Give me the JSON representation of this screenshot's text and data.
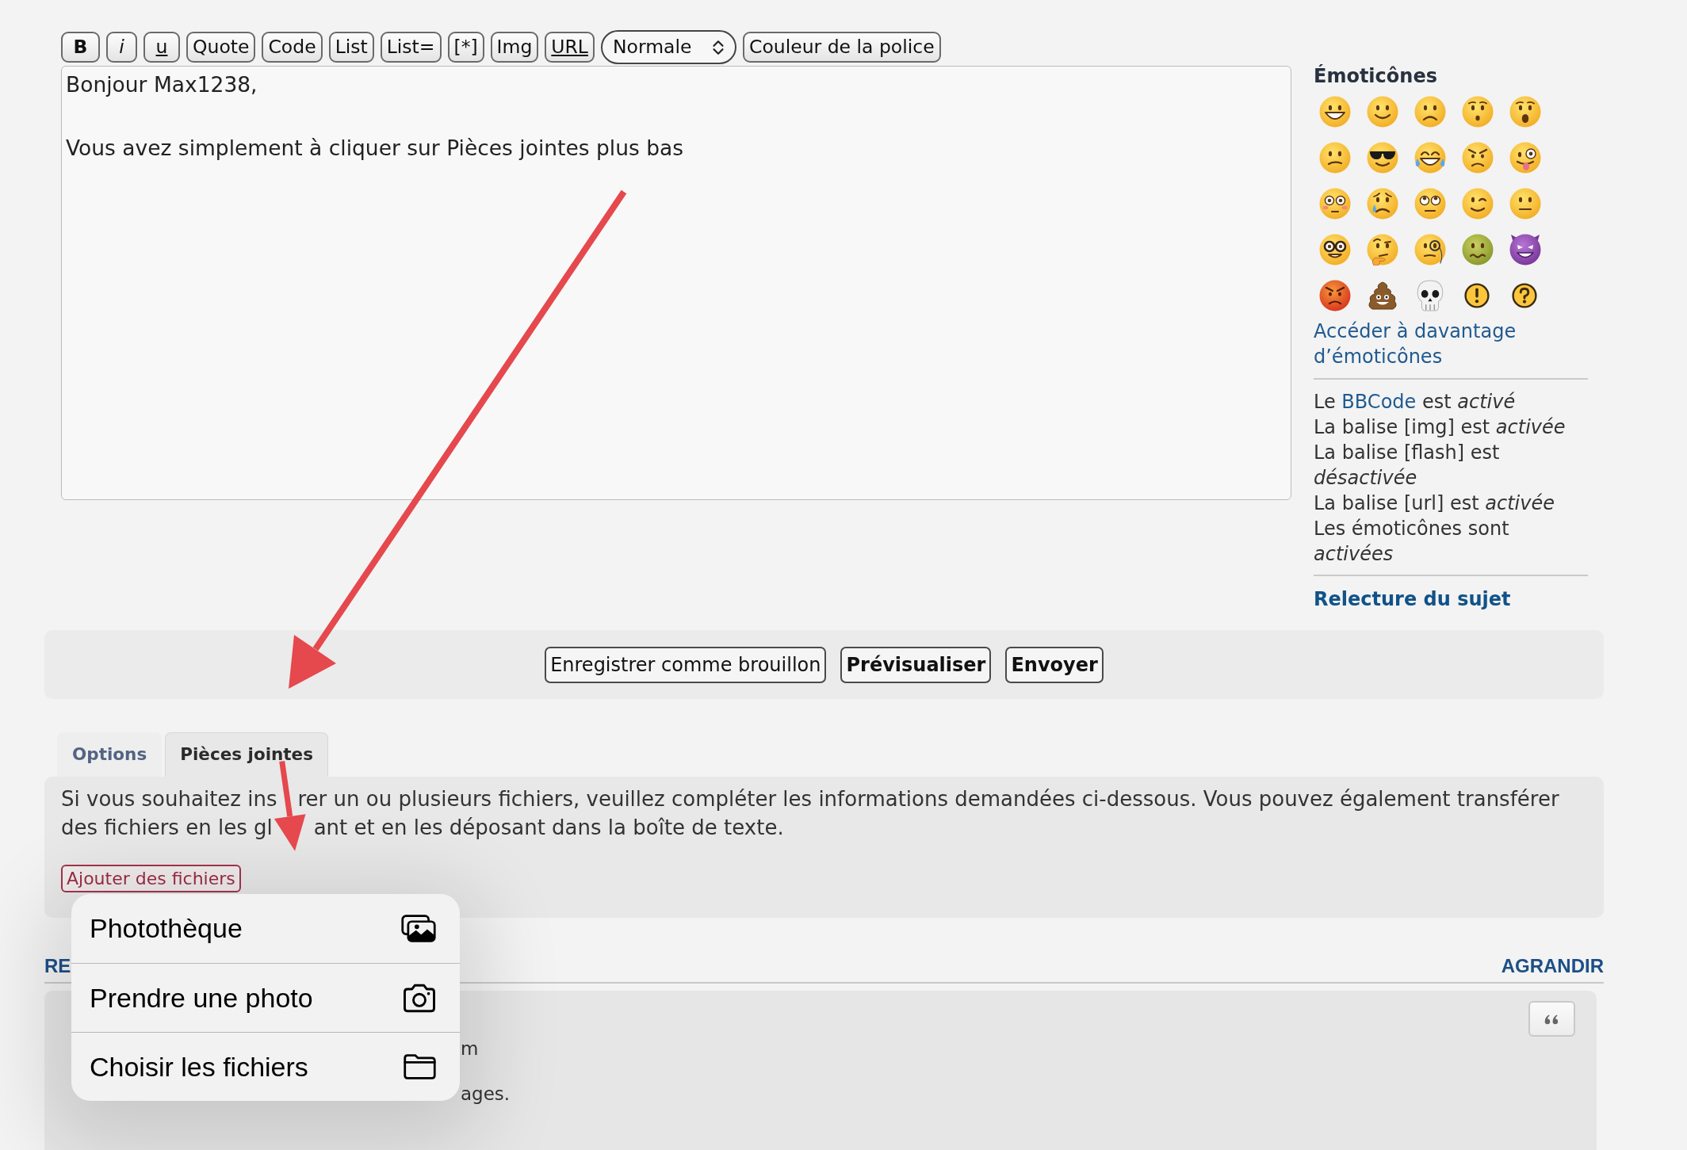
{
  "toolbar": [
    {
      "kind": "bold",
      "label": "B"
    },
    {
      "kind": "italic",
      "label": "i"
    },
    {
      "kind": "underline",
      "label": "u"
    },
    {
      "kind": "plain",
      "label": "Quote"
    },
    {
      "kind": "plain",
      "label": "Code"
    },
    {
      "kind": "plain",
      "label": "List"
    },
    {
      "kind": "plain",
      "label": "List="
    },
    {
      "kind": "plain",
      "label": "[*]"
    },
    {
      "kind": "plain",
      "label": "Img"
    },
    {
      "kind": "underline",
      "label": "URL"
    },
    {
      "kind": "select",
      "value": "Normale"
    },
    {
      "kind": "plain",
      "label": "Couleur de la police"
    }
  ],
  "message": {
    "value": "Bonjour Max1238,\n\nVous avez simplement à cliquer sur Pièces jointes plus bas"
  },
  "emoticons": {
    "title": "Émoticônes",
    "more_link": "Accéder à davantage d’émoticônes"
  },
  "status_lines": [
    {
      "kind": "link",
      "before": "Le",
      "link": "BBCode",
      "after": "est *activé*"
    },
    {
      "kind": "text",
      "text": "La balise [img] est *activée*"
    },
    {
      "kind": "text",
      "text": "La balise [flash] est *désactivée*"
    },
    {
      "kind": "text",
      "text": "La balise [url] est *activée*"
    },
    {
      "kind": "text",
      "text": "Les émoticônes sont *activées*"
    }
  ],
  "review_link": "Relecture du sujet",
  "actions": [
    {
      "label": "Enregistrer comme brouillon",
      "emphasized": false
    },
    {
      "label": "Prévisualiser",
      "emphasized": true
    },
    {
      "label": "Envoyer",
      "emphasized": true
    }
  ],
  "tabs": [
    {
      "label": "Options",
      "selected": false
    },
    {
      "label": "Pièces jointes",
      "selected": true
    }
  ],
  "attachments": {
    "description_lines": [
      [
        "Si vous souhaitez ins",
        "rer un ou plusieurs fichiers, veuillez compléter les informations demandées ci-dessous. Vous pouvez également transférer"
      ],
      [
        "des fichiers en les gl",
        "ant et en les déposant dans la boîte de texte."
      ]
    ],
    "add_button": "Ajouter des fichiers"
  },
  "file_menu": [
    {
      "kind": "photos",
      "label": "Photothèque"
    },
    {
      "kind": "camera",
      "label": "Prendre une photo"
    },
    {
      "kind": "folder",
      "label": "Choisir les fichiers"
    }
  ],
  "review": {
    "heading": "RE",
    "expand_link": "AGRANDIR",
    "fragments": [
      "m",
      "ages."
    ]
  }
}
